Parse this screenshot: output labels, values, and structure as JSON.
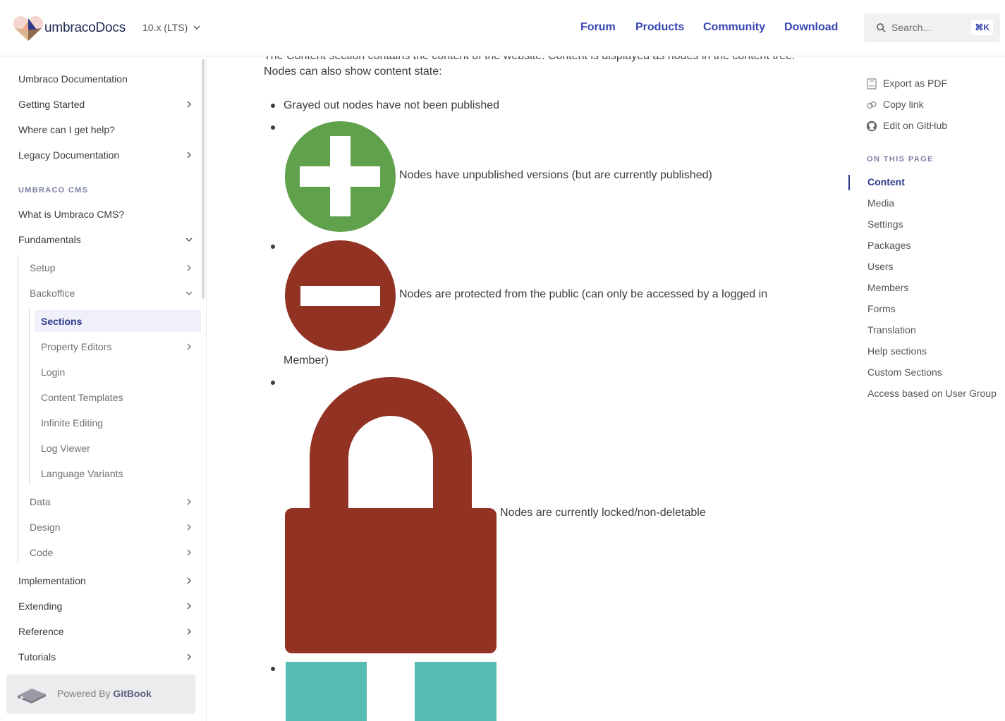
{
  "header": {
    "brand": "umbracoDocs",
    "version": "10.x (LTS)",
    "nav": [
      "Forum",
      "Products",
      "Community",
      "Download"
    ],
    "search_placeholder": "Search...",
    "shortcut": "⌘K"
  },
  "sidebar": {
    "top_items": [
      "Umbraco Documentation",
      "Getting Started",
      "Where can I get help?",
      "Legacy Documentation"
    ],
    "section_label": "UMBRACO CMS",
    "cms_items": [
      "What is Umbraco CMS?",
      "Fundamentals"
    ],
    "fundamentals_children": [
      "Setup",
      "Backoffice"
    ],
    "backoffice_children": [
      "Sections",
      "Property Editors",
      "Login",
      "Content Templates",
      "Infinite Editing",
      "Log Viewer",
      "Language Variants"
    ],
    "fundamentals_more": [
      "Data",
      "Design",
      "Code"
    ],
    "bottom_items": [
      "Implementation",
      "Extending",
      "Reference",
      "Tutorials"
    ],
    "active_item": "Sections",
    "powered_prefix": "Powered By",
    "powered_brand": "GitBook"
  },
  "content": {
    "intro_line1": "The Content section contains the content of the website. Content is displayed as nodes in the content tree.",
    "intro_line2": "Nodes can also show content state:",
    "items": [
      "Grayed out nodes have not been published",
      "Nodes have unpublished versions (but are currently published)",
      "Nodes are protected from the public (can only be accessed by a logged in",
      "Member)",
      "Nodes are currently locked/non-deletable"
    ],
    "colors": {
      "green": "#60a14c",
      "red": "#923222",
      "teal": "#57bcb4"
    }
  },
  "toc": {
    "actions": [
      "Export as PDF",
      "Copy link",
      "Edit on GitHub"
    ],
    "heading": "ON THIS PAGE",
    "items": [
      "Content",
      "Media",
      "Settings",
      "Packages",
      "Users",
      "Members",
      "Forms",
      "Translation",
      "Help sections",
      "Custom Sections",
      "Access based on User Group"
    ],
    "active": "Content"
  }
}
